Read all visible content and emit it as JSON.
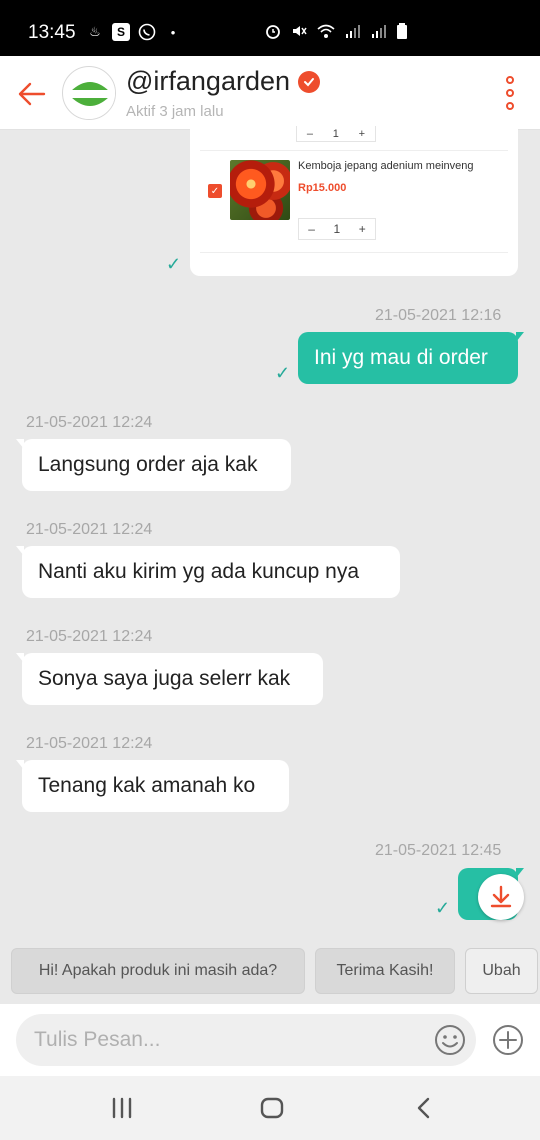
{
  "status_bar": {
    "time": "13:45"
  },
  "header": {
    "shop_name": "@irfangarden",
    "active_status": "Aktif 3 jam lalu",
    "avatar_text": "IRFANGARDEN"
  },
  "product": {
    "name": "Kemboja jepang adenium meinveng",
    "price": "Rp15.000",
    "quantity": "1",
    "minus": "–",
    "plus": "+"
  },
  "messages": [
    {
      "direction": "out",
      "timestamp": "21-05-2021 12:16",
      "text": "Ini yg mau di order"
    },
    {
      "direction": "in",
      "timestamp": "21-05-2021 12:24",
      "text": "Langsung order aja kak"
    },
    {
      "direction": "in",
      "timestamp": "21-05-2021 12:24",
      "text": "Nanti aku kirim yg ada kuncup nya"
    },
    {
      "direction": "in",
      "timestamp": "21-05-2021 12:24",
      "text": "Sonya saya juga selerr kak"
    },
    {
      "direction": "in",
      "timestamp": "21-05-2021 12:24",
      "text": "Tenang kak amanah ko"
    },
    {
      "direction": "out",
      "timestamp": "21-05-2021 12:45",
      "text": ""
    }
  ],
  "quick_replies": [
    "Hi! Apakah produk ini masih ada?",
    "Terima Kasih!",
    "Ubah"
  ],
  "input": {
    "placeholder": "Tulis Pesan..."
  },
  "colors": {
    "brand": "#ee4d2d",
    "sent_bubble": "#26bfa4",
    "read_tick": "#26aa99"
  }
}
